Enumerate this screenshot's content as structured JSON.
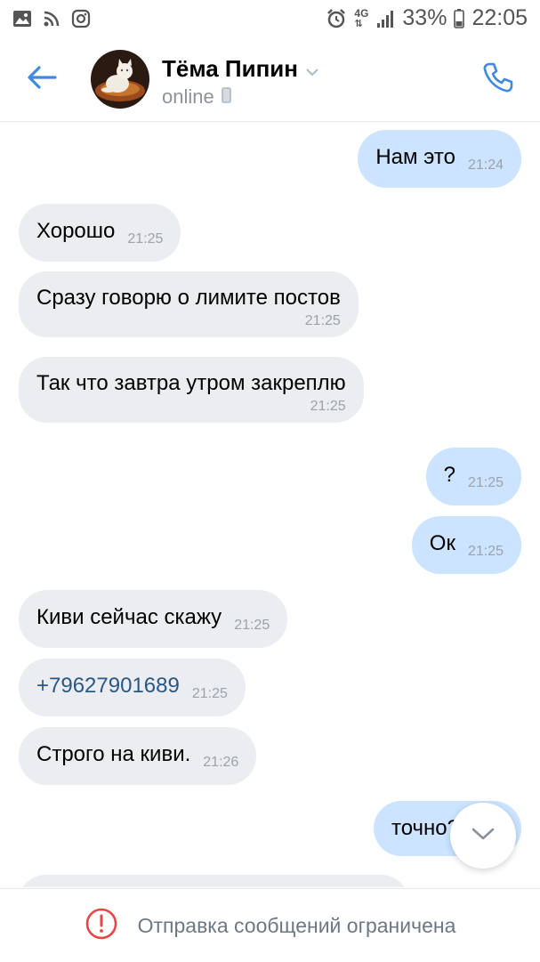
{
  "status_bar": {
    "left_icons": [
      "image-icon",
      "rss-icon",
      "instagram-icon"
    ],
    "alarm_icon": "alarm-icon",
    "network_label": "4G",
    "signal_icon": "signal-icon",
    "battery_percent": "33%",
    "battery_icon": "battery-icon",
    "time": "22:05"
  },
  "header": {
    "back_icon": "arrow-left-icon",
    "avatar": "cat-avatar",
    "name": "Тёма Пипин",
    "status": "online",
    "call_icon": "phone-icon",
    "accent_color": "#3f8ae0"
  },
  "messages": [
    {
      "dir": "out",
      "text": "Нам это",
      "time": "21:24"
    },
    {
      "dir": "in",
      "text": "Хорошо",
      "time": "21:25"
    },
    {
      "dir": "in",
      "text": "Сразу говорю о лимите постов",
      "time": "21:25"
    },
    {
      "dir": "in",
      "text": "Так что завтра утром закреплю",
      "time": "21:25"
    },
    {
      "dir": "out",
      "text": "?",
      "time": "21:25"
    },
    {
      "dir": "out",
      "text": "Ок",
      "time": "21:25"
    },
    {
      "dir": "in",
      "text": "Киви сейчас скажу",
      "time": "21:25"
    },
    {
      "dir": "in",
      "text": "+79627901689",
      "time": "21:25",
      "link": true
    },
    {
      "dir": "in",
      "text": "Строго на киви.",
      "time": "21:26"
    },
    {
      "dir": "out",
      "text": "точно?",
      "time": ""
    }
  ],
  "colors": {
    "outgoing_bubble": "#cce4ff",
    "incoming_bubble": "#ebedf0",
    "link": "#2a5885",
    "alert_red": "#e64646"
  },
  "footer": {
    "icon": "alert-circle-icon",
    "text": "Отправка сообщений ограничена"
  },
  "scroll_button_icon": "chevron-down-icon"
}
